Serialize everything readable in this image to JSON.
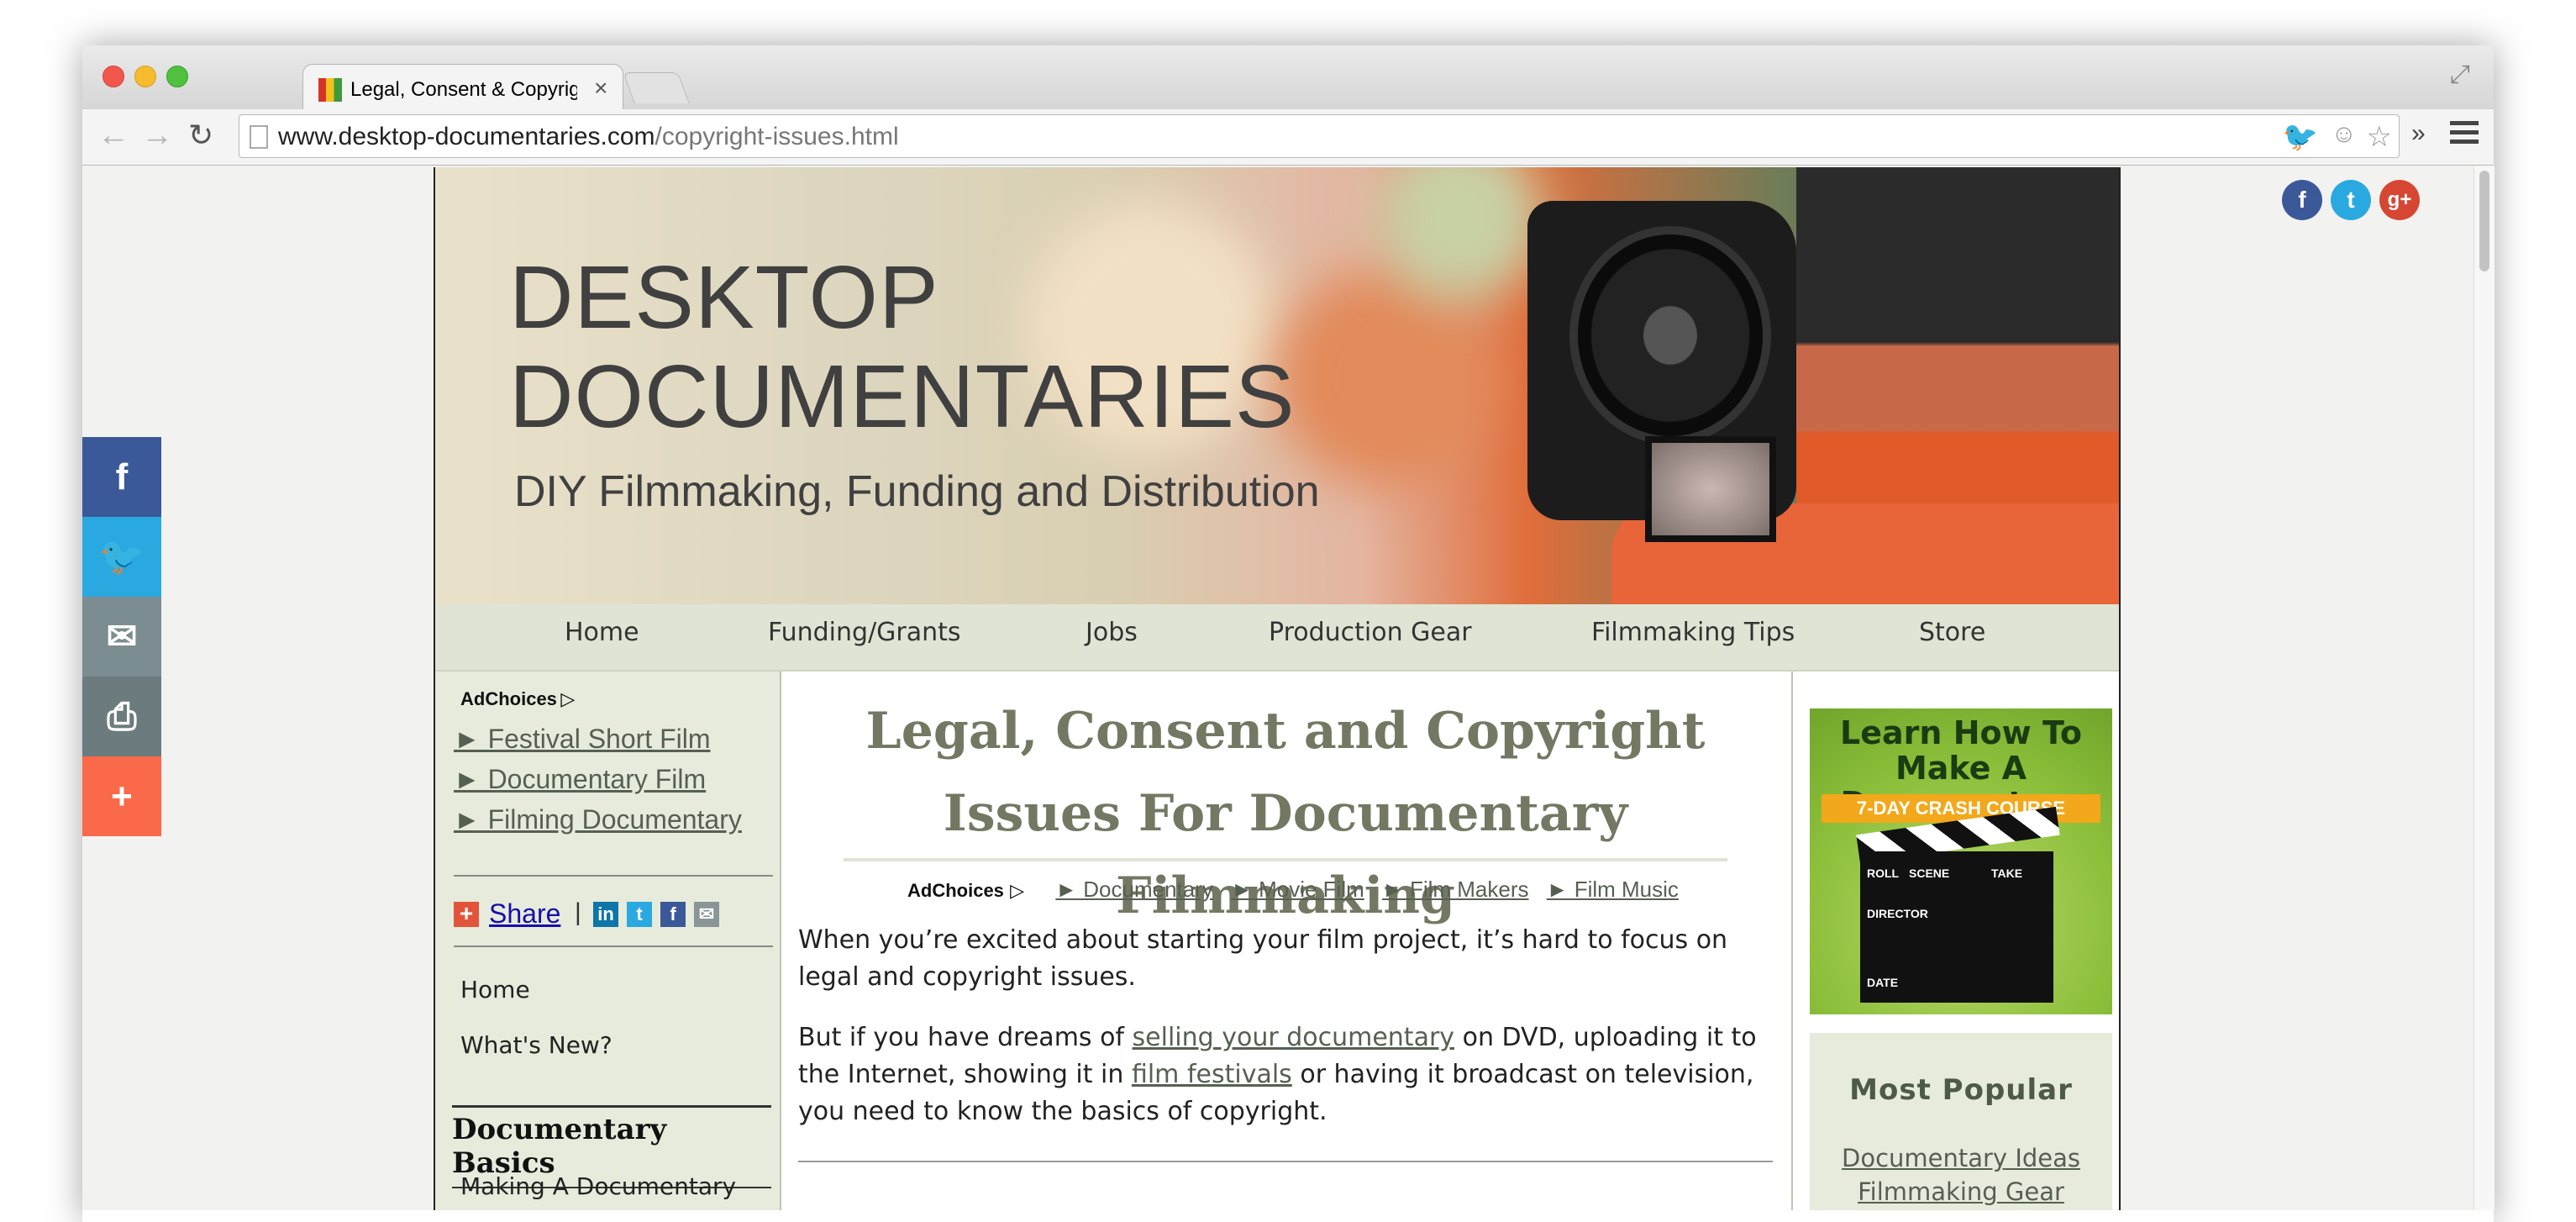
{
  "browser": {
    "tab_title": "Legal, Consent & Copyrigh",
    "url_host": "www.desktop-documentaries.com",
    "url_path": "/copyright-issues.html",
    "overflow_glyph": "»"
  },
  "header": {
    "logo_line1": "DESKTOP",
    "logo_line2": "DOCUMENTARIES",
    "tagline": "DIY Filmmaking, Funding and Distribution"
  },
  "nav": [
    "Home",
    "Funding/Grants",
    "Jobs",
    "Production Gear",
    "Filmmaking Tips",
    "Store"
  ],
  "left_sidebar": {
    "adchoices": "AdChoices",
    "ad_links": [
      "► Festival Short Film",
      "► Documentary Film",
      "► Filming Documentary"
    ],
    "share_label": "Share",
    "share_sep": "|",
    "links": [
      "Home",
      "What's New?"
    ],
    "section_title": "Documentary Basics",
    "section_links": [
      "Making A Documentary"
    ]
  },
  "main": {
    "title": "Legal, Consent and Copyright Issues For Documentary Filmmaking",
    "adchoices": "AdChoices",
    "ad_links": [
      "► Documentary",
      "► Movie Film",
      "► Film Makers",
      "► Film Music"
    ],
    "p1": "When you’re excited about starting your film project, it’s hard to focus on legal and copyright issues.",
    "p2_a": "But if you have dreams of ",
    "p2_link1": "selling your documentary",
    "p2_b": " on DVD, uploading it to the Internet, showing it in ",
    "p2_link2": "film festivals",
    "p2_c": " or having it broadcast on television, you need to know the basics of copyright."
  },
  "right_sidebar": {
    "promo_title": "Learn How To Make A Documentary",
    "promo_banner": "7-DAY CRASH COURSE",
    "clap_labels": [
      "ROLL",
      "SCENE",
      "TAKE",
      "DIRECTOR",
      "DATE"
    ],
    "popular_title": "Most Popular",
    "popular_links": [
      "Documentary Ideas",
      "Filmmaking Gear"
    ]
  },
  "colors": {
    "facebook": "#3b5998",
    "twitter": "#2aa9e0",
    "email": "#7b8d90",
    "print": "#6c7b7e",
    "more": "#fa6a4a",
    "google_plus": "#d64733",
    "accent_text": "#737863"
  },
  "icons": {
    "float_bar": [
      "facebook-icon",
      "twitter-icon",
      "email-icon",
      "print-icon",
      "plus-icon"
    ]
  }
}
